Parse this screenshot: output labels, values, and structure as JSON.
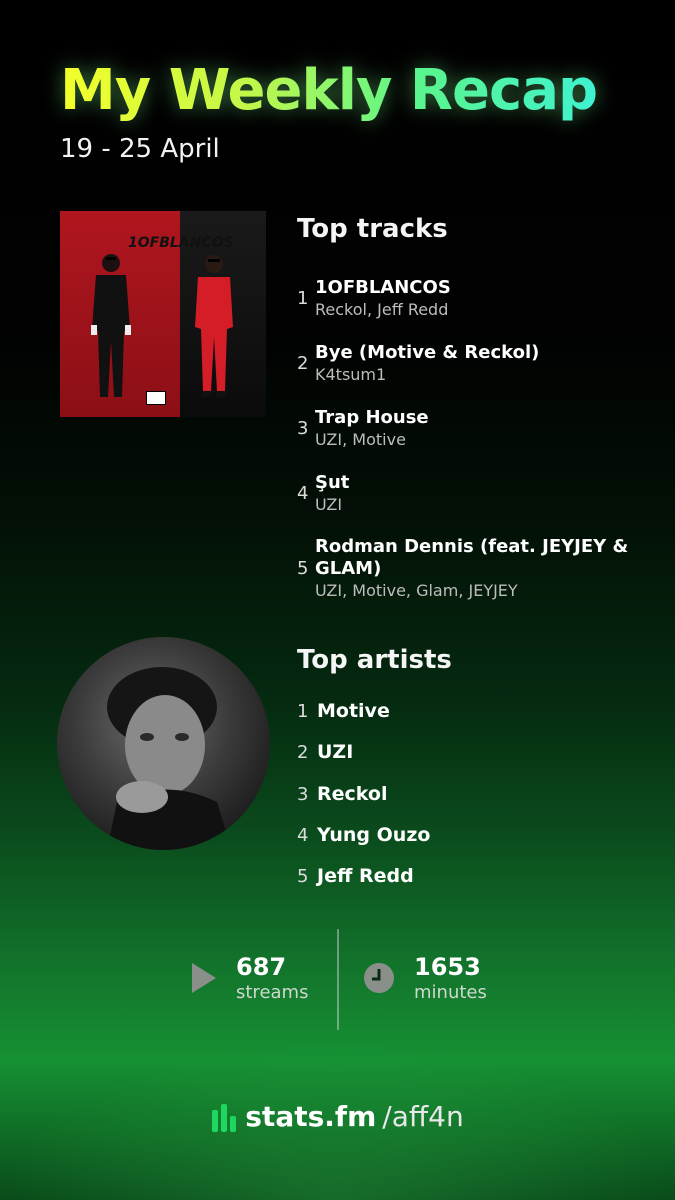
{
  "header": {
    "title": "My Weekly Recap",
    "date_range": "19 - 25 April"
  },
  "top_tracks": {
    "heading": "Top tracks",
    "album_art_text": "1OFBLANCOS",
    "items": [
      {
        "rank": "1",
        "name": "1OFBLANCOS",
        "artist": "Reckol, Jeff Redd"
      },
      {
        "rank": "2",
        "name": "Bye (Motive & Reckol)",
        "artist": "K4tsum1"
      },
      {
        "rank": "3",
        "name": "Trap House",
        "artist": "UZI, Motive"
      },
      {
        "rank": "4",
        "name": "Şut",
        "artist": "UZI"
      },
      {
        "rank": "5",
        "name": "Rodman Dennis (feat. JEYJEY & GLAM)",
        "artist": "UZI, Motive, Glam, JEYJEY"
      }
    ]
  },
  "top_artists": {
    "heading": "Top artists",
    "items": [
      {
        "rank": "1",
        "name": "Motive"
      },
      {
        "rank": "2",
        "name": "UZI"
      },
      {
        "rank": "3",
        "name": "Reckol"
      },
      {
        "rank": "4",
        "name": "Yung Ouzo"
      },
      {
        "rank": "5",
        "name": "Jeff Redd"
      }
    ]
  },
  "stats": {
    "streams": {
      "value": "687",
      "label": "streams",
      "icon": "play-icon"
    },
    "minutes": {
      "value": "1653",
      "label": "minutes",
      "icon": "clock-icon"
    }
  },
  "footer": {
    "brand": "stats.fm",
    "separator": "/",
    "username": "aff4n",
    "icon": "bars-logo-icon"
  },
  "colors": {
    "accent_green": "#1ed760",
    "title_gradient_start": "#f4ff2a",
    "title_gradient_end": "#3ff2d0"
  }
}
